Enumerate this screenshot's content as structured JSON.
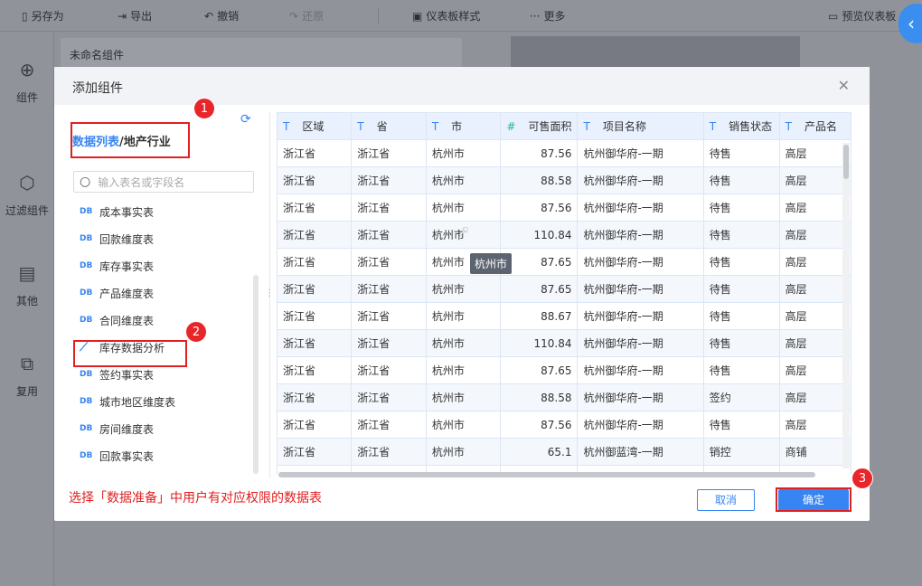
{
  "toolbar": {
    "save_as": "另存为",
    "export": "导出",
    "undo": "撤销",
    "redo": "还原",
    "dashboard_style": "仪表板样式",
    "more": "更多",
    "preview": "预览仪表板"
  },
  "sidebar": {
    "component": "组件",
    "filter": "过滤组件",
    "other": "其他",
    "reuse": "复用"
  },
  "canvas": {
    "card_title": "未命名组件"
  },
  "modal": {
    "title": "添加组件",
    "breadcrumb": {
      "root": "数据列表",
      "separator": "/",
      "current": "地产行业"
    },
    "search_placeholder": "输入表名或字段名",
    "tables": [
      {
        "label": "成本事实表",
        "type": "DB"
      },
      {
        "label": "回款维度表",
        "type": "DB"
      },
      {
        "label": "库存事实表",
        "type": "DB"
      },
      {
        "label": "产品维度表",
        "type": "DB"
      },
      {
        "label": "合同维度表",
        "type": "DB"
      },
      {
        "label": "库存数据分析",
        "type": "analysis"
      },
      {
        "label": "签约事实表",
        "type": "DB"
      },
      {
        "label": "城市地区维度表",
        "type": "DB"
      },
      {
        "label": "房间维度表",
        "type": "DB"
      },
      {
        "label": "回款事实表",
        "type": "DB"
      }
    ],
    "columns": [
      {
        "type": "T",
        "name": "区域"
      },
      {
        "type": "T",
        "name": "省"
      },
      {
        "type": "T",
        "name": "市"
      },
      {
        "type": "#",
        "name": "可售面积"
      },
      {
        "type": "T",
        "name": "项目名称"
      },
      {
        "type": "T",
        "name": "销售状态"
      },
      {
        "type": "T",
        "name": "产品名"
      }
    ],
    "rows": [
      [
        "浙江省",
        "浙江省",
        "杭州市",
        "87.56",
        "杭州御华府-一期",
        "待售",
        "高层"
      ],
      [
        "浙江省",
        "浙江省",
        "杭州市",
        "88.58",
        "杭州御华府-一期",
        "待售",
        "高层"
      ],
      [
        "浙江省",
        "浙江省",
        "杭州市",
        "87.56",
        "杭州御华府-一期",
        "待售",
        "高层"
      ],
      [
        "浙江省",
        "浙江省",
        "杭州市",
        "110.84",
        "杭州御华府-一期",
        "待售",
        "高层"
      ],
      [
        "浙江省",
        "浙江省",
        "杭州市",
        "87.65",
        "杭州御华府-一期",
        "待售",
        "高层"
      ],
      [
        "浙江省",
        "浙江省",
        "杭州市",
        "87.65",
        "杭州御华府-一期",
        "待售",
        "高层"
      ],
      [
        "浙江省",
        "浙江省",
        "杭州市",
        "88.67",
        "杭州御华府-一期",
        "待售",
        "高层"
      ],
      [
        "浙江省",
        "浙江省",
        "杭州市",
        "110.84",
        "杭州御华府-一期",
        "待售",
        "高层"
      ],
      [
        "浙江省",
        "浙江省",
        "杭州市",
        "87.65",
        "杭州御华府-一期",
        "待售",
        "高层"
      ],
      [
        "浙江省",
        "浙江省",
        "杭州市",
        "88.58",
        "杭州御华府-一期",
        "签约",
        "高层"
      ],
      [
        "浙江省",
        "浙江省",
        "杭州市",
        "87.56",
        "杭州御华府-一期",
        "待售",
        "高层"
      ],
      [
        "浙江省",
        "浙江省",
        "杭州市",
        "65.1",
        "杭州御蓝湾-一期",
        "销控",
        "商铺"
      ],
      [
        "",
        "",
        "",
        "",
        "",
        "",
        ""
      ]
    ],
    "tooltip": "杭州市",
    "note": "选择「数据准备」中用户有对应权限的数据表",
    "cancel": "取消",
    "confirm": "确定"
  },
  "annotations": [
    "1",
    "2",
    "3"
  ]
}
